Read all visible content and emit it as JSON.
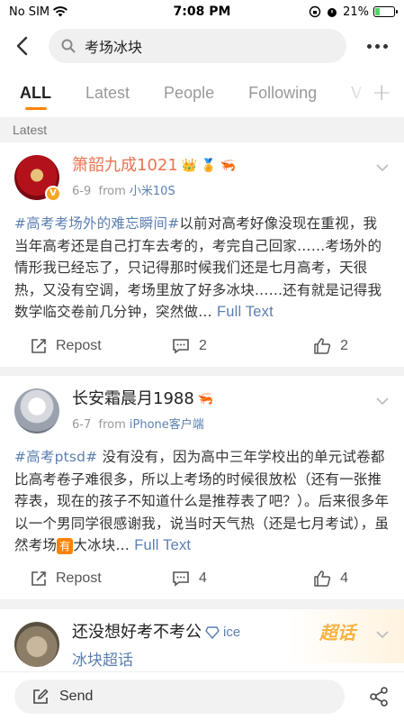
{
  "status_bar": {
    "carrier": "No SIM",
    "time": "7:08 PM",
    "battery": "21%",
    "battery_level": 0.21
  },
  "search": {
    "query": "考场冰块"
  },
  "tabs": [
    {
      "label": "ALL",
      "active": true
    },
    {
      "label": "Latest",
      "active": false
    },
    {
      "label": "People",
      "active": false
    },
    {
      "label": "Following",
      "active": false
    },
    {
      "label": "V",
      "active": false
    }
  ],
  "section_label": "Latest",
  "posts": [
    {
      "username": "箫韶九成1021",
      "date": "6-9",
      "from_label": "from",
      "source": "小米10S",
      "tag": "#高考考场外的难忘瞬间#",
      "text": "以前对高考好像没现在重视，我当年高考还是自己打车去考的，考完自己回家……考场外的情形我已经忘了，只记得那时候我们还是七月高考，天很热，又没有空调，考场里放了好多冰块……还有就是记得我数学临交卷前几分钟，突然做…",
      "full_text": "Full Text",
      "repost": "Repost",
      "comments": "2",
      "likes": "2"
    },
    {
      "username": "长安霜晨月1988",
      "date": "6-7",
      "from_label": "from",
      "source": "iPhone客户端",
      "tag": "#高考ptsd#",
      "text_before": " 没有没有，因为高中三年学校出的单元试卷都比高考卷子难很多，所以上考场的时候很放松（还有一张推荐表，现在的孩子不知道什么是推荐表了吧？）。后来很多年以一个男同学很感谢我，说当时天气热（还是七月考试），虽然考场",
      "mark": "有",
      "text_after": "大冰块…",
      "full_text": "Full Text",
      "repost": "Repost",
      "comments": "4",
      "likes": "4"
    },
    {
      "username": "还没想好考不考公",
      "badge_text": "ice",
      "topic": "冰块超话",
      "chaohua": "超话"
    }
  ],
  "bottom": {
    "send_label": "Send"
  }
}
